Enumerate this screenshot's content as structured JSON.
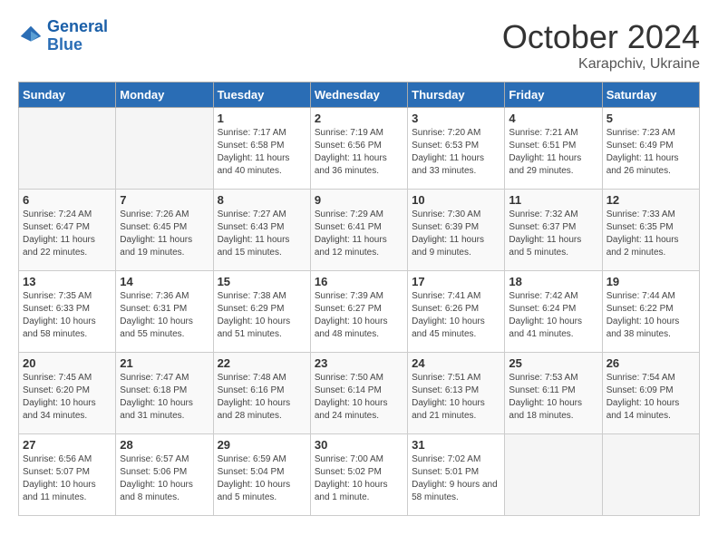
{
  "header": {
    "logo_line1": "General",
    "logo_line2": "Blue",
    "month": "October 2024",
    "location": "Karapchiv, Ukraine"
  },
  "weekdays": [
    "Sunday",
    "Monday",
    "Tuesday",
    "Wednesday",
    "Thursday",
    "Friday",
    "Saturday"
  ],
  "weeks": [
    [
      {
        "day": "",
        "empty": true
      },
      {
        "day": "",
        "empty": true
      },
      {
        "day": "1",
        "sunrise": "Sunrise: 7:17 AM",
        "sunset": "Sunset: 6:58 PM",
        "daylight": "Daylight: 11 hours and 40 minutes."
      },
      {
        "day": "2",
        "sunrise": "Sunrise: 7:19 AM",
        "sunset": "Sunset: 6:56 PM",
        "daylight": "Daylight: 11 hours and 36 minutes."
      },
      {
        "day": "3",
        "sunrise": "Sunrise: 7:20 AM",
        "sunset": "Sunset: 6:53 PM",
        "daylight": "Daylight: 11 hours and 33 minutes."
      },
      {
        "day": "4",
        "sunrise": "Sunrise: 7:21 AM",
        "sunset": "Sunset: 6:51 PM",
        "daylight": "Daylight: 11 hours and 29 minutes."
      },
      {
        "day": "5",
        "sunrise": "Sunrise: 7:23 AM",
        "sunset": "Sunset: 6:49 PM",
        "daylight": "Daylight: 11 hours and 26 minutes."
      }
    ],
    [
      {
        "day": "6",
        "sunrise": "Sunrise: 7:24 AM",
        "sunset": "Sunset: 6:47 PM",
        "daylight": "Daylight: 11 hours and 22 minutes."
      },
      {
        "day": "7",
        "sunrise": "Sunrise: 7:26 AM",
        "sunset": "Sunset: 6:45 PM",
        "daylight": "Daylight: 11 hours and 19 minutes."
      },
      {
        "day": "8",
        "sunrise": "Sunrise: 7:27 AM",
        "sunset": "Sunset: 6:43 PM",
        "daylight": "Daylight: 11 hours and 15 minutes."
      },
      {
        "day": "9",
        "sunrise": "Sunrise: 7:29 AM",
        "sunset": "Sunset: 6:41 PM",
        "daylight": "Daylight: 11 hours and 12 minutes."
      },
      {
        "day": "10",
        "sunrise": "Sunrise: 7:30 AM",
        "sunset": "Sunset: 6:39 PM",
        "daylight": "Daylight: 11 hours and 9 minutes."
      },
      {
        "day": "11",
        "sunrise": "Sunrise: 7:32 AM",
        "sunset": "Sunset: 6:37 PM",
        "daylight": "Daylight: 11 hours and 5 minutes."
      },
      {
        "day": "12",
        "sunrise": "Sunrise: 7:33 AM",
        "sunset": "Sunset: 6:35 PM",
        "daylight": "Daylight: 11 hours and 2 minutes."
      }
    ],
    [
      {
        "day": "13",
        "sunrise": "Sunrise: 7:35 AM",
        "sunset": "Sunset: 6:33 PM",
        "daylight": "Daylight: 10 hours and 58 minutes."
      },
      {
        "day": "14",
        "sunrise": "Sunrise: 7:36 AM",
        "sunset": "Sunset: 6:31 PM",
        "daylight": "Daylight: 10 hours and 55 minutes."
      },
      {
        "day": "15",
        "sunrise": "Sunrise: 7:38 AM",
        "sunset": "Sunset: 6:29 PM",
        "daylight": "Daylight: 10 hours and 51 minutes."
      },
      {
        "day": "16",
        "sunrise": "Sunrise: 7:39 AM",
        "sunset": "Sunset: 6:27 PM",
        "daylight": "Daylight: 10 hours and 48 minutes."
      },
      {
        "day": "17",
        "sunrise": "Sunrise: 7:41 AM",
        "sunset": "Sunset: 6:26 PM",
        "daylight": "Daylight: 10 hours and 45 minutes."
      },
      {
        "day": "18",
        "sunrise": "Sunrise: 7:42 AM",
        "sunset": "Sunset: 6:24 PM",
        "daylight": "Daylight: 10 hours and 41 minutes."
      },
      {
        "day": "19",
        "sunrise": "Sunrise: 7:44 AM",
        "sunset": "Sunset: 6:22 PM",
        "daylight": "Daylight: 10 hours and 38 minutes."
      }
    ],
    [
      {
        "day": "20",
        "sunrise": "Sunrise: 7:45 AM",
        "sunset": "Sunset: 6:20 PM",
        "daylight": "Daylight: 10 hours and 34 minutes."
      },
      {
        "day": "21",
        "sunrise": "Sunrise: 7:47 AM",
        "sunset": "Sunset: 6:18 PM",
        "daylight": "Daylight: 10 hours and 31 minutes."
      },
      {
        "day": "22",
        "sunrise": "Sunrise: 7:48 AM",
        "sunset": "Sunset: 6:16 PM",
        "daylight": "Daylight: 10 hours and 28 minutes."
      },
      {
        "day": "23",
        "sunrise": "Sunrise: 7:50 AM",
        "sunset": "Sunset: 6:14 PM",
        "daylight": "Daylight: 10 hours and 24 minutes."
      },
      {
        "day": "24",
        "sunrise": "Sunrise: 7:51 AM",
        "sunset": "Sunset: 6:13 PM",
        "daylight": "Daylight: 10 hours and 21 minutes."
      },
      {
        "day": "25",
        "sunrise": "Sunrise: 7:53 AM",
        "sunset": "Sunset: 6:11 PM",
        "daylight": "Daylight: 10 hours and 18 minutes."
      },
      {
        "day": "26",
        "sunrise": "Sunrise: 7:54 AM",
        "sunset": "Sunset: 6:09 PM",
        "daylight": "Daylight: 10 hours and 14 minutes."
      }
    ],
    [
      {
        "day": "27",
        "sunrise": "Sunrise: 6:56 AM",
        "sunset": "Sunset: 5:07 PM",
        "daylight": "Daylight: 10 hours and 11 minutes."
      },
      {
        "day": "28",
        "sunrise": "Sunrise: 6:57 AM",
        "sunset": "Sunset: 5:06 PM",
        "daylight": "Daylight: 10 hours and 8 minutes."
      },
      {
        "day": "29",
        "sunrise": "Sunrise: 6:59 AM",
        "sunset": "Sunset: 5:04 PM",
        "daylight": "Daylight: 10 hours and 5 minutes."
      },
      {
        "day": "30",
        "sunrise": "Sunrise: 7:00 AM",
        "sunset": "Sunset: 5:02 PM",
        "daylight": "Daylight: 10 hours and 1 minute."
      },
      {
        "day": "31",
        "sunrise": "Sunrise: 7:02 AM",
        "sunset": "Sunset: 5:01 PM",
        "daylight": "Daylight: 9 hours and 58 minutes."
      },
      {
        "day": "",
        "empty": true
      },
      {
        "day": "",
        "empty": true
      }
    ]
  ]
}
